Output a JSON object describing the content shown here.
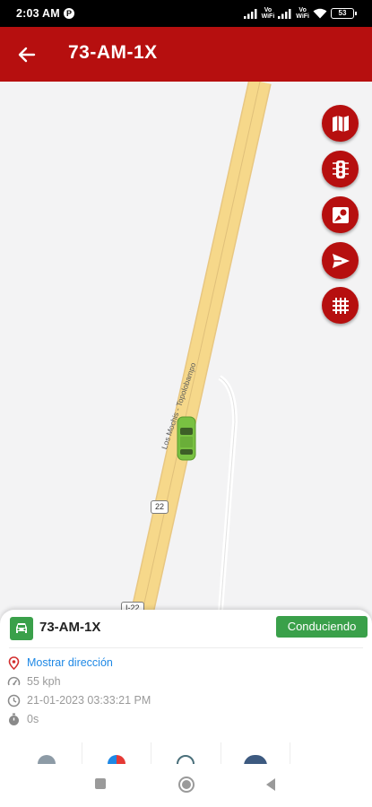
{
  "status_bar": {
    "time": "2:03 AM",
    "app_badge": "P",
    "volte_1": "Vo\nWiFi",
    "volte_2": "Vo\nWiFi",
    "battery": "53"
  },
  "header": {
    "title": "73-AM-1X",
    "back_icon": "arrow-left-icon",
    "background_color": "#b60f0f"
  },
  "map": {
    "road_name": "Los Mochis - Topolobampo",
    "road_shields": [
      "22",
      "I-22"
    ],
    "map_buttons": [
      {
        "icon": "map-icon"
      },
      {
        "icon": "traffic-light-icon"
      },
      {
        "icon": "geofence-icon"
      },
      {
        "icon": "send-icon"
      },
      {
        "icon": "grid-icon"
      }
    ],
    "vehicle_color": "#79c142"
  },
  "vehicle_card": {
    "plate": "73-AM-1X",
    "status": "Conduciendo",
    "status_color": "#3aa04a",
    "address_link": "Mostrar dirección",
    "speed": "55 kph",
    "datetime": "21-01-2023 03:33:21 PM",
    "duration": "0s"
  },
  "navigation": {
    "recents": "square-icon",
    "home": "circle-icon",
    "back": "triangle-back-icon"
  }
}
